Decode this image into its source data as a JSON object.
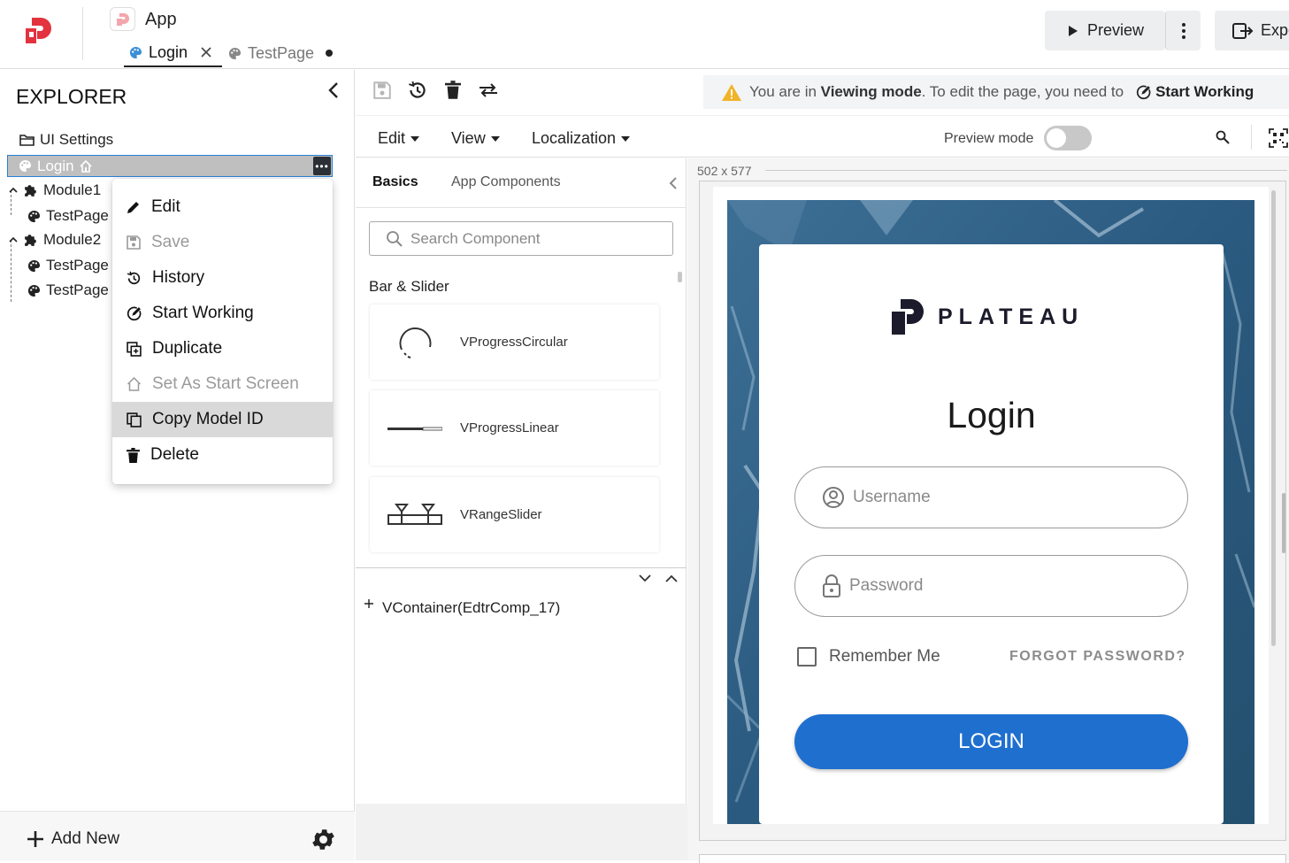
{
  "header": {
    "app_title": "App",
    "tabs": [
      {
        "label": "Login",
        "active": true
      },
      {
        "label": "TestPage",
        "active": false,
        "unsaved": true
      }
    ],
    "preview_label": "Preview",
    "export_label": "Expo"
  },
  "explorer": {
    "title": "EXPLORER",
    "items": [
      {
        "label": "UI Settings",
        "icon": "folder-icon"
      },
      {
        "label": "Login",
        "icon": "palette-icon",
        "selected": true,
        "start_screen": true
      },
      {
        "label": "Module1",
        "icon": "puzzle-icon"
      },
      {
        "label": "TestPage",
        "icon": "palette-icon"
      },
      {
        "label": "Module2",
        "icon": "puzzle-icon"
      },
      {
        "label": "TestPage",
        "icon": "palette-icon"
      },
      {
        "label": "TestPage",
        "icon": "palette-icon"
      }
    ],
    "add_new_label": "Add New"
  },
  "context_menu": {
    "items": [
      {
        "label": "Edit",
        "icon": "pencil-icon",
        "disabled": false
      },
      {
        "label": "Save",
        "icon": "save-icon",
        "disabled": true
      },
      {
        "label": "History",
        "icon": "history-icon",
        "disabled": false
      },
      {
        "label": "Start Working",
        "icon": "edit-circle-icon",
        "disabled": false
      },
      {
        "label": "Duplicate",
        "icon": "duplicate-icon",
        "disabled": false
      },
      {
        "label": "Set As Start Screen",
        "icon": "home-outline-icon",
        "disabled": true
      },
      {
        "label": "Copy Model ID",
        "icon": "copy-icon",
        "disabled": false,
        "highlighted": true
      },
      {
        "label": "Delete",
        "icon": "trash-icon",
        "disabled": false
      }
    ]
  },
  "notice": {
    "prefix": "You are in ",
    "mode": "Viewing mode",
    "suffix": ". To edit the page, you need to",
    "action": "Start Working"
  },
  "menubar": {
    "edit": "Edit",
    "view": "View",
    "localization": "Localization",
    "preview_mode_label": "Preview mode",
    "preview_mode_on": false
  },
  "components": {
    "tabs": [
      "Basics",
      "App Components"
    ],
    "search_placeholder": "Search Component",
    "section_title": "Bar & Slider",
    "items": [
      "VProgressCircular",
      "VProgressLinear",
      "VRangeSlider"
    ]
  },
  "component_tree": {
    "node": "VContainer(EdtrComp_17)"
  },
  "canvas": {
    "dimensions": "502 x 577"
  },
  "login_page": {
    "brand": "PLATEAU",
    "title": "Login",
    "username_placeholder": "Username",
    "password_placeholder": "Password",
    "remember_me": "Remember Me",
    "forgot_password": "FORGOT PASSWORD?",
    "login_button": "LOGIN"
  },
  "colors": {
    "brand_red": "#e2333f",
    "primary_blue": "#1f6fcf",
    "selection_border": "#2a7fd4",
    "warning": "#f0b429",
    "ice_background": "#2e5d82"
  }
}
